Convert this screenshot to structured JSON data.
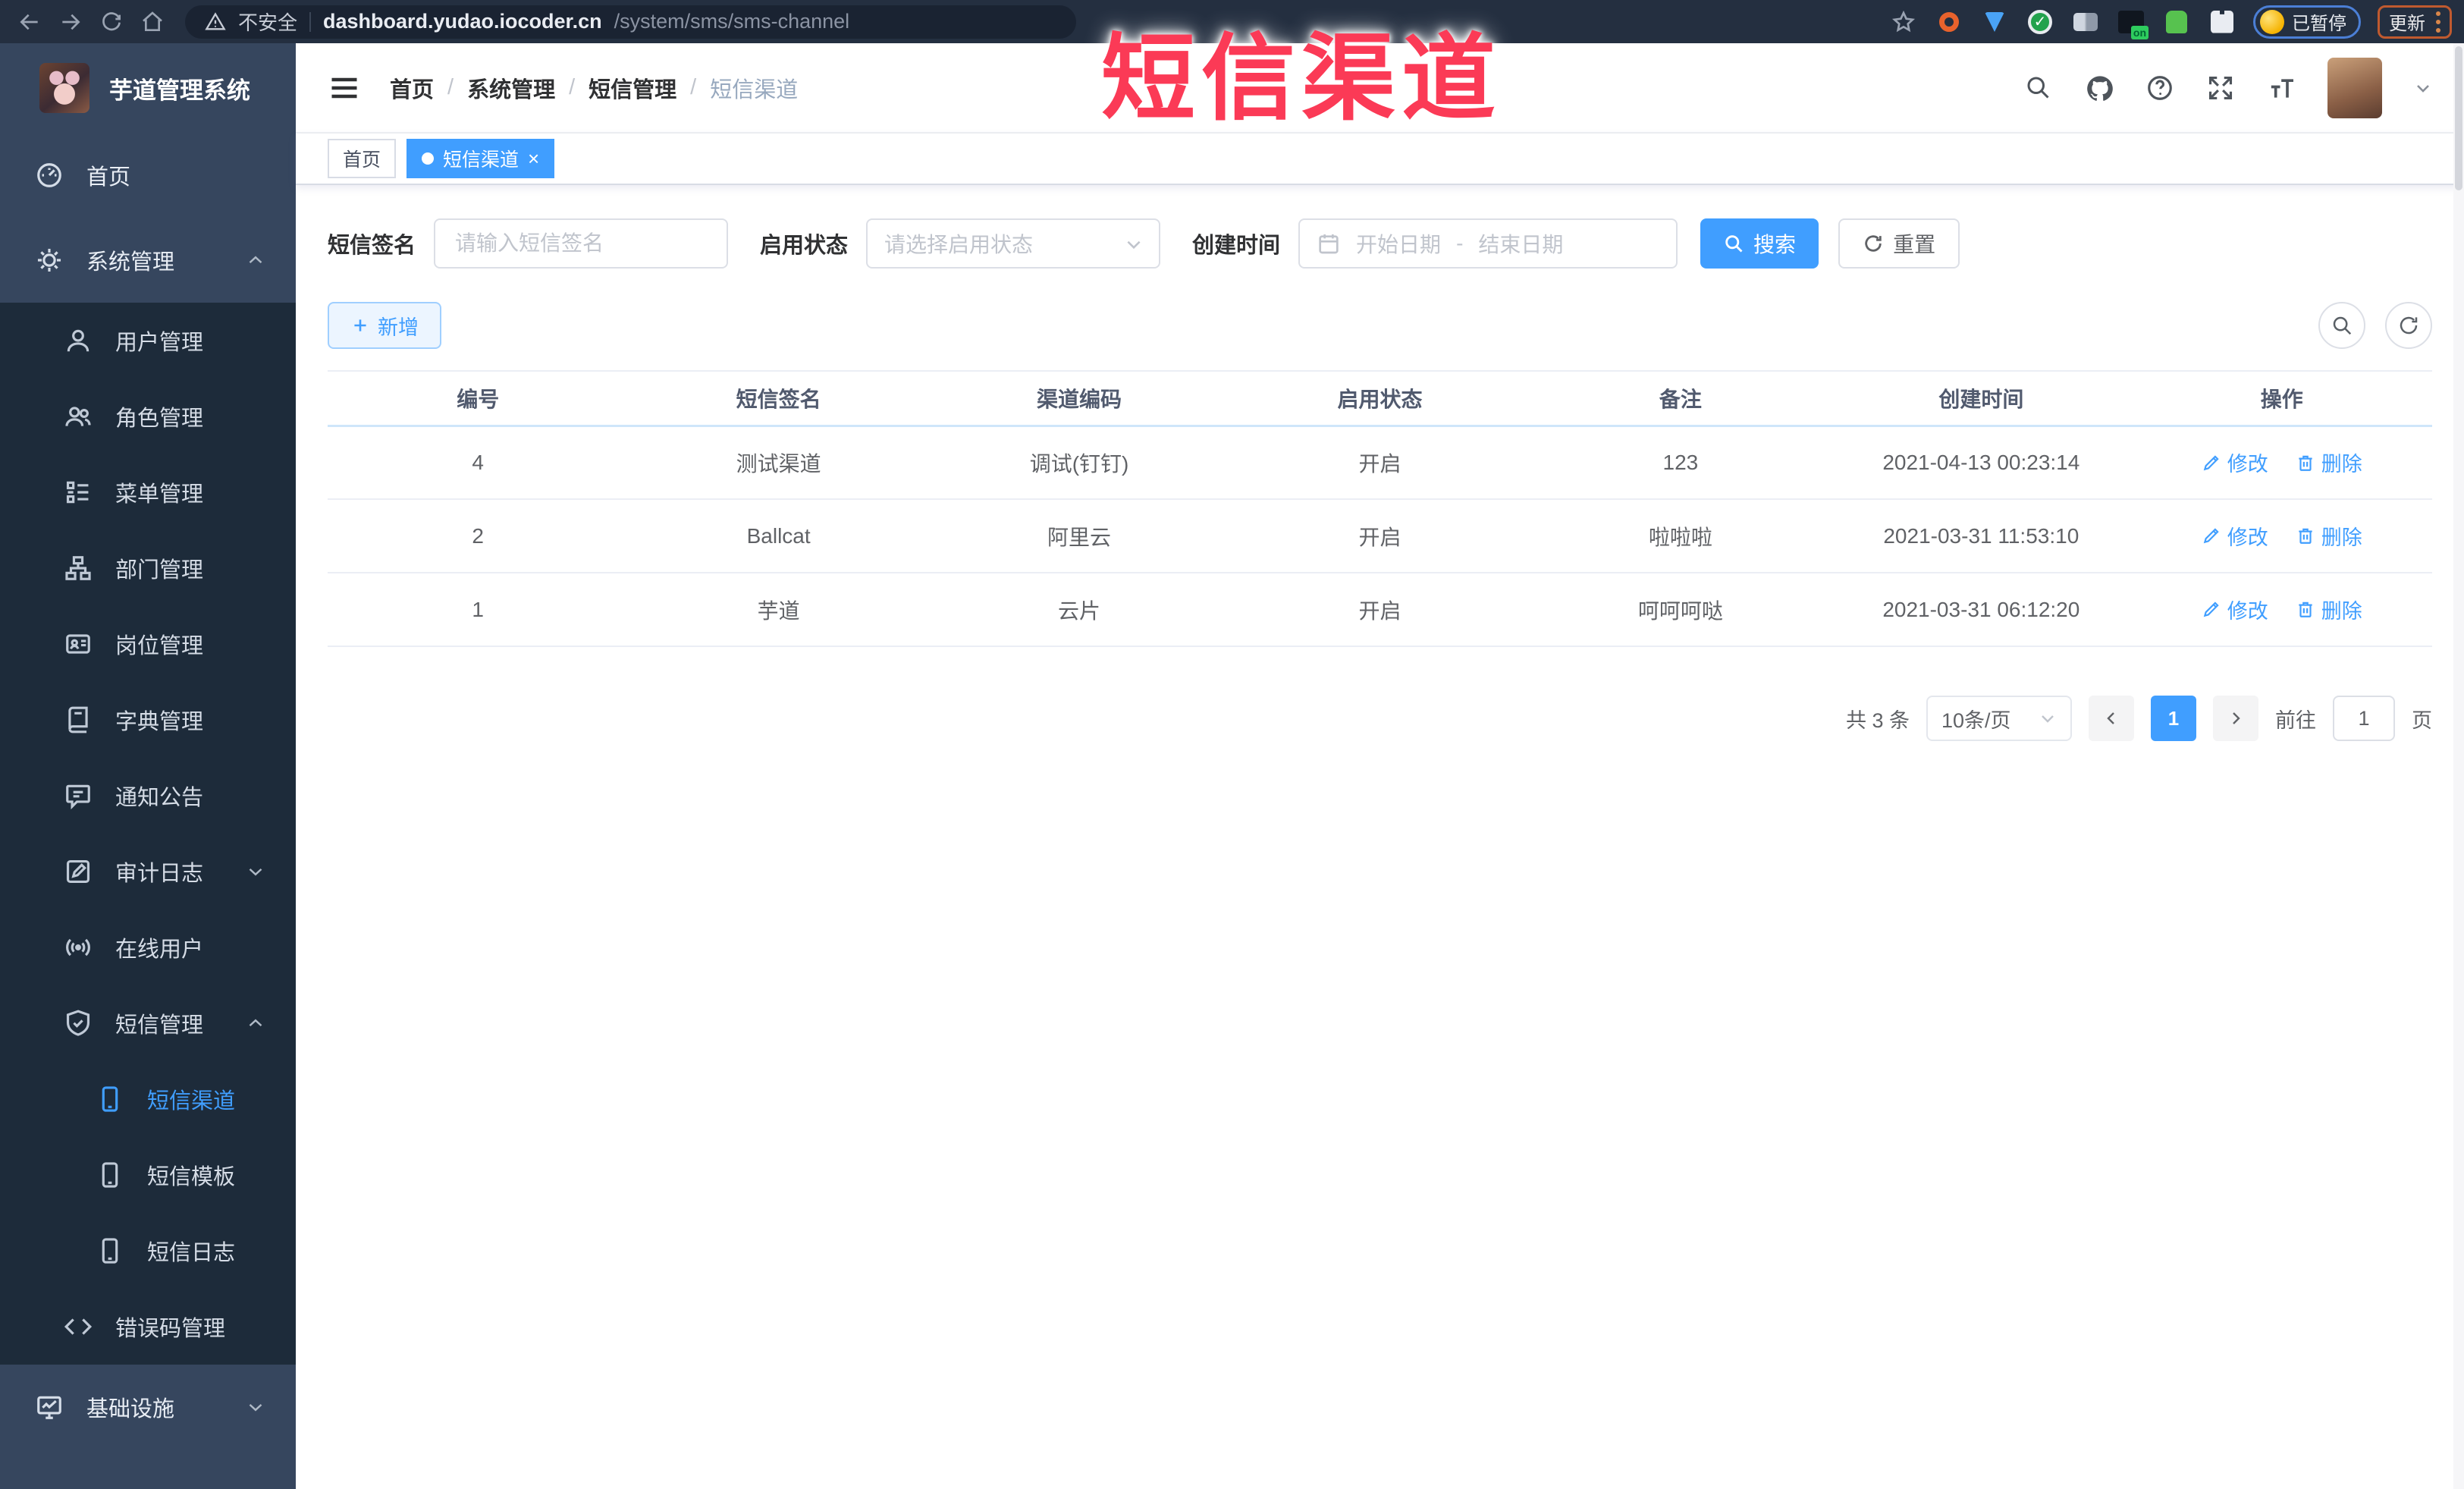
{
  "browser": {
    "security_label": "不安全",
    "url_domain": "dashboard.yudao.iocoder.cn",
    "url_path": "/system/sms/sms-channel",
    "paused_label": "已暂停",
    "update_label": "更新"
  },
  "overlay": {
    "title": "短信渠道",
    "color": "#fb3a56"
  },
  "sidebar": {
    "app_title": "芋道管理系统",
    "items": [
      {
        "label": "首页"
      },
      {
        "label": "系统管理"
      },
      {
        "label": "用户管理"
      },
      {
        "label": "角色管理"
      },
      {
        "label": "菜单管理"
      },
      {
        "label": "部门管理"
      },
      {
        "label": "岗位管理"
      },
      {
        "label": "字典管理"
      },
      {
        "label": "通知公告"
      },
      {
        "label": "审计日志"
      },
      {
        "label": "在线用户"
      },
      {
        "label": "短信管理"
      },
      {
        "label": "短信渠道"
      },
      {
        "label": "短信模板"
      },
      {
        "label": "短信日志"
      },
      {
        "label": "错误码管理"
      },
      {
        "label": "基础设施"
      }
    ]
  },
  "header": {
    "breadcrumb": [
      "首页",
      "系统管理",
      "短信管理",
      "短信渠道"
    ],
    "separator": "/"
  },
  "tabs": [
    {
      "label": "首页"
    },
    {
      "label": "短信渠道",
      "close": "×"
    }
  ],
  "filters": {
    "sign_label": "短信签名",
    "sign_placeholder": "请输入短信签名",
    "status_label": "启用状态",
    "status_placeholder": "请选择启用状态",
    "time_label": "创建时间",
    "start_placeholder": "开始日期",
    "range_separator": "-",
    "end_placeholder": "结束日期",
    "search_label": "搜索",
    "reset_label": "重置"
  },
  "toolbar": {
    "add_label": "新增"
  },
  "table": {
    "columns": [
      "编号",
      "短信签名",
      "渠道编码",
      "启用状态",
      "备注",
      "创建时间",
      "操作"
    ],
    "actions": {
      "edit": "修改",
      "delete": "删除"
    },
    "rows": [
      {
        "id": "4",
        "sign": "测试渠道",
        "code": "调试(钉钉)",
        "status": "开启",
        "remark": "123",
        "created": "2021-04-13 00:23:14"
      },
      {
        "id": "2",
        "sign": "Ballcat",
        "code": "阿里云",
        "status": "开启",
        "remark": "啦啦啦",
        "created": "2021-03-31 11:53:10"
      },
      {
        "id": "1",
        "sign": "芋道",
        "code": "云片",
        "status": "开启",
        "remark": "呵呵呵哒",
        "created": "2021-03-31 06:12:20"
      }
    ]
  },
  "pagination": {
    "total_label": "共 3 条",
    "page_size": "10条/页",
    "current_page": "1",
    "goto_label": "前往",
    "goto_value": "1",
    "page_unit": "页"
  },
  "colors": {
    "accent": "#409eff",
    "sidebar_bg": "#36465e",
    "submenu_bg": "#1d2b3a"
  }
}
